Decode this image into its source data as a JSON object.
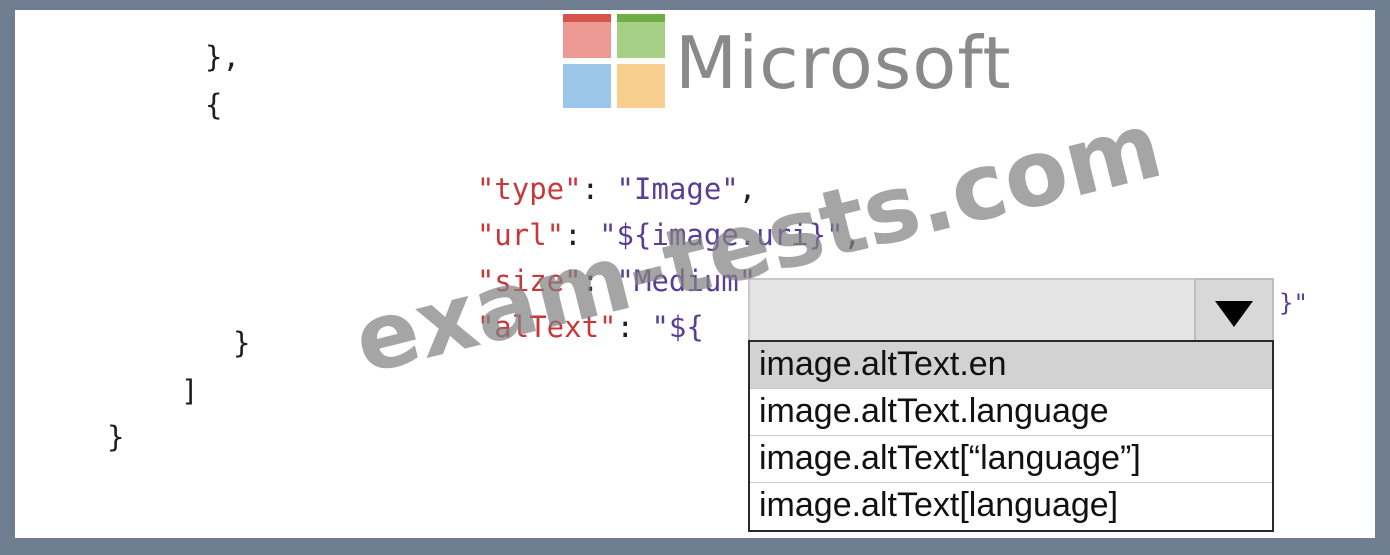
{
  "code_lines": {
    "l1": "},",
    "l2": "{",
    "type_key": "\"type\"",
    "type_val": "\"Image\"",
    "url_key": "\"url\"",
    "url_val": "\"${image.uri}\"",
    "size_key": "\"size\"",
    "size_val": "\"Medium\"",
    "alt_key": "\"alText\"",
    "alt_val_prefix": "\"${",
    "alt_val_suffix": "}\"",
    "close_brace": "}",
    "close_bracket": "]",
    "final_brace": "}"
  },
  "punct": {
    "colon": ":",
    "comma": ","
  },
  "logo": {
    "text": "Microsoft",
    "colors": [
      "#d6544c",
      "#6fae47",
      "#9cc5ea",
      "#f8cf8e"
    ]
  },
  "watermark": "exam-tests.com",
  "dropdown": {
    "selected_value": "",
    "selected_option_index": 0,
    "options": [
      "image.altText.en",
      "image.altText.language",
      "image.altText[“language”]",
      "image.altText[language]"
    ]
  }
}
